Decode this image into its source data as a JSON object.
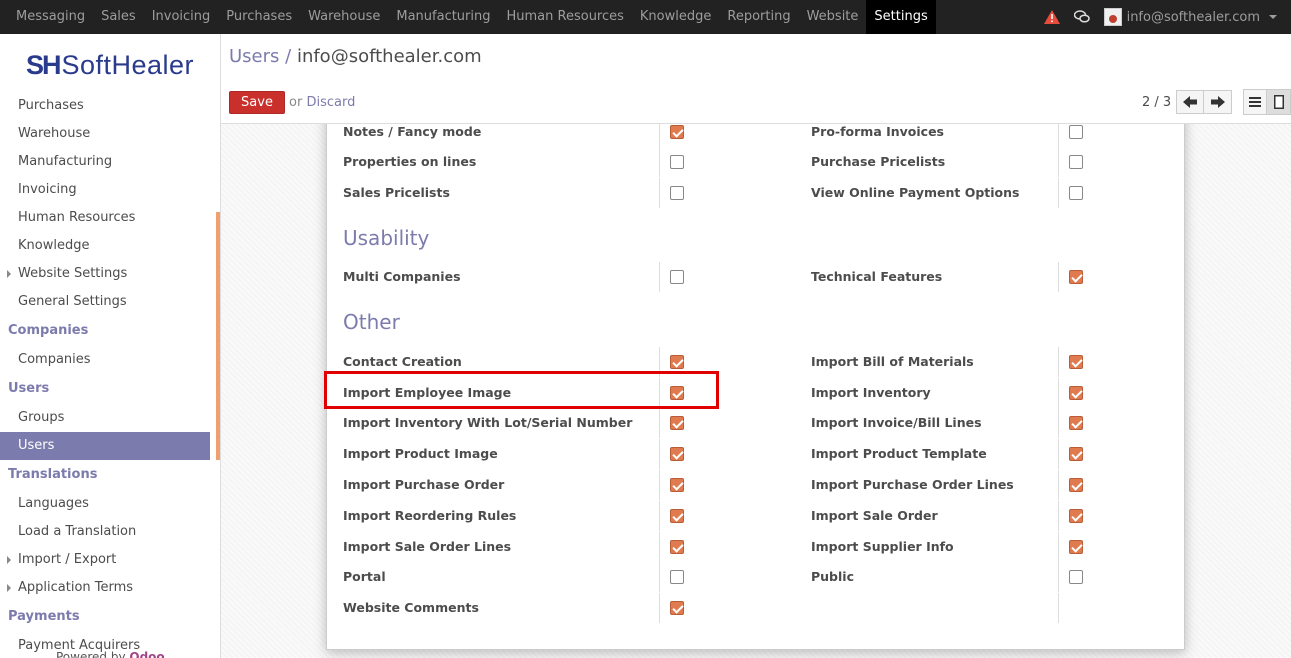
{
  "topbar": {
    "menu": [
      "Messaging",
      "Sales",
      "Invoicing",
      "Purchases",
      "Warehouse",
      "Manufacturing",
      "Human Resources",
      "Knowledge",
      "Reporting",
      "Website",
      "Settings"
    ],
    "active": "Settings",
    "user": "info@softhealer.com",
    "colors": {
      "bg": "#222222",
      "warning": "#e74c3c"
    }
  },
  "sidebar": {
    "logo_mark": "SH",
    "logo_text": "SoftHealer",
    "items": [
      {
        "type": "item",
        "label": "Purchases"
      },
      {
        "type": "item",
        "label": "Warehouse"
      },
      {
        "type": "item",
        "label": "Manufacturing"
      },
      {
        "type": "item",
        "label": "Invoicing"
      },
      {
        "type": "item",
        "label": "Human Resources"
      },
      {
        "type": "item",
        "label": "Knowledge"
      },
      {
        "type": "item",
        "label": "Website Settings",
        "caret": true
      },
      {
        "type": "item",
        "label": "General Settings"
      },
      {
        "type": "head",
        "label": "Companies"
      },
      {
        "type": "item",
        "label": "Companies"
      },
      {
        "type": "head",
        "label": "Users"
      },
      {
        "type": "item",
        "label": "Groups"
      },
      {
        "type": "item",
        "label": "Users",
        "selected": true
      },
      {
        "type": "head",
        "label": "Translations"
      },
      {
        "type": "item",
        "label": "Languages"
      },
      {
        "type": "item",
        "label": "Load a Translation"
      },
      {
        "type": "item",
        "label": "Import / Export",
        "caret": true
      },
      {
        "type": "item",
        "label": "Application Terms",
        "caret": true
      },
      {
        "type": "head",
        "label": "Payments"
      },
      {
        "type": "item",
        "label": "Payment Acquirers"
      }
    ],
    "powered_prefix": "Powered by ",
    "powered_brand": "Odoo"
  },
  "control": {
    "breadcrumb_parent": "Users /",
    "breadcrumb_current": "info@softhealer.com",
    "save_label": "Save",
    "or_label": "or",
    "discard_label": "Discard",
    "pager": "2 / 3"
  },
  "form": {
    "rows_top": [
      {
        "left": "Notes / Fancy mode",
        "left_checked": true,
        "right": "Pro-forma Invoices",
        "right_checked": false
      },
      {
        "left": "Properties on lines",
        "left_checked": false,
        "right": "Purchase Pricelists",
        "right_checked": false
      },
      {
        "left": "Sales Pricelists",
        "left_checked": false,
        "right": "View Online Payment Options",
        "right_checked": false
      }
    ],
    "usability_title": "Usability",
    "rows_usability": [
      {
        "left": "Multi Companies",
        "left_checked": false,
        "right": "Technical Features",
        "right_checked": true
      }
    ],
    "other_title": "Other",
    "rows_other": [
      {
        "left": "Contact Creation",
        "left_checked": true,
        "right": "Import Bill of Materials",
        "right_checked": true
      },
      {
        "left": "Import Employee Image",
        "left_checked": true,
        "right": "Import Inventory",
        "right_checked": true
      },
      {
        "left": "Import Inventory With Lot/Serial Number",
        "left_checked": true,
        "right": "Import Invoice/Bill Lines",
        "right_checked": true
      },
      {
        "left": "Import Product Image",
        "left_checked": true,
        "right": "Import Product Template",
        "right_checked": true
      },
      {
        "left": "Import Purchase Order",
        "left_checked": true,
        "right": "Import Purchase Order Lines",
        "right_checked": true
      },
      {
        "left": "Import Reordering Rules",
        "left_checked": true,
        "right": "Import Sale Order",
        "right_checked": true
      },
      {
        "left": "Import Sale Order Lines",
        "left_checked": true,
        "right": "Import Supplier Info",
        "right_checked": true
      },
      {
        "left": "Portal",
        "left_checked": false,
        "right": "Public",
        "right_checked": false
      },
      {
        "left": "Website Comments",
        "left_checked": true,
        "right": "",
        "right_checked": null
      }
    ],
    "accent_color": "#e07b50",
    "highlight_color": "#e00000"
  }
}
